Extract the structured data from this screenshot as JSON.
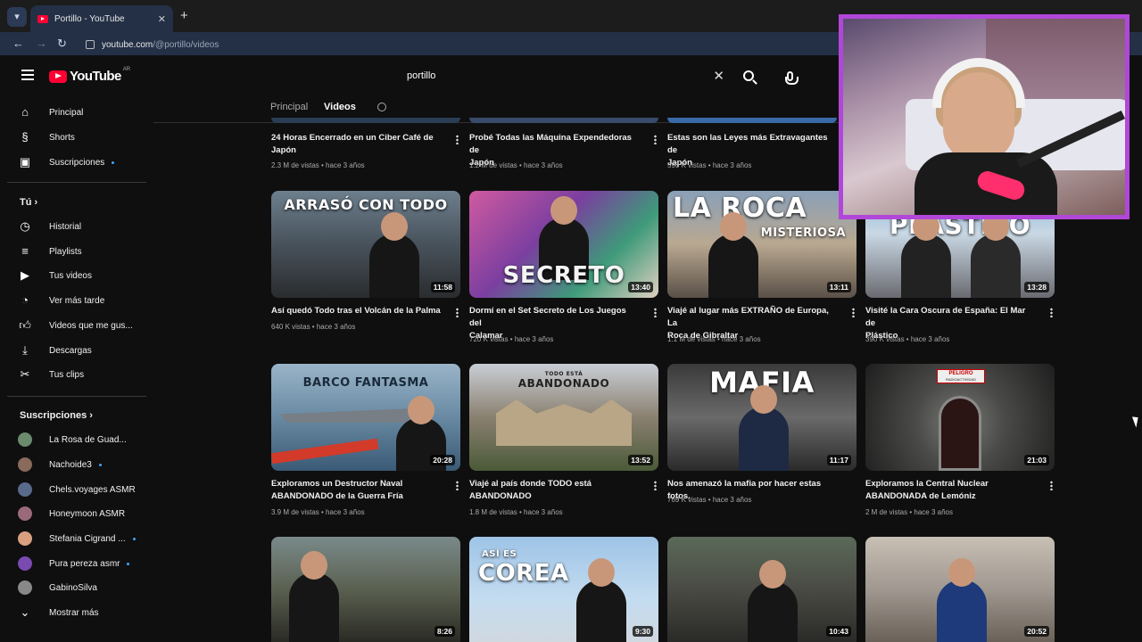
{
  "browser": {
    "tab_title": "Portillo - YouTube",
    "url_host": "youtube.com",
    "url_path": "/@portillo/videos"
  },
  "yt": {
    "logo": "YouTube",
    "country": "AR",
    "search_value": "portillo"
  },
  "sidebar": {
    "main": [
      {
        "label": "Principal",
        "icon": "home-icon"
      },
      {
        "label": "Shorts",
        "icon": "shorts-icon"
      },
      {
        "label": "Suscripciones",
        "icon": "subscriptions-icon"
      }
    ],
    "you_heading": "Tú",
    "you": [
      {
        "label": "Historial",
        "icon": "history-icon"
      },
      {
        "label": "Playlists",
        "icon": "playlists-icon"
      },
      {
        "label": "Tus videos",
        "icon": "your-videos-icon"
      },
      {
        "label": "Ver más tarde",
        "icon": "watch-later-icon"
      },
      {
        "label": "Videos que me gus...",
        "icon": "like-icon"
      },
      {
        "label": "Descargas",
        "icon": "download-icon"
      },
      {
        "label": "Tus clips",
        "icon": "clips-icon"
      }
    ],
    "subs_heading": "Suscripciones",
    "subs": [
      {
        "label": "La Rosa de Guad...",
        "color": "#6b8a6e"
      },
      {
        "label": "Nachoide3",
        "color": "#8a6a5a"
      },
      {
        "label": "Chels.voyages ASMR",
        "color": "#5a6a8a"
      },
      {
        "label": "Honeymoon ASMR",
        "color": "#9a6a7a"
      },
      {
        "label": "Stefania Cigrand ...",
        "color": "#d9a080"
      },
      {
        "label": "Pura pereza asmr",
        "color": "#7a4ab0"
      },
      {
        "label": "GabinoSilva",
        "color": "#888888"
      }
    ],
    "more": "Mostrar más"
  },
  "channel_tabs": {
    "home": "Principal",
    "videos": "Videos"
  },
  "videos_top": [
    {
      "title_1": "24 Horas Encerrado en un Ciber Café de",
      "title_2": "Japón",
      "meta": "2.3 M de vistas • hace 3 años"
    },
    {
      "title_1": "Probé Todas las Máquina Expendedoras de",
      "title_2": "Japón",
      "meta": "1.2 M de vistas • hace 3 años"
    },
    {
      "title_1": "Estas son las Leyes más Extravagantes de",
      "title_2": "Japón",
      "meta": "590 K vistas • hace 3 años"
    }
  ],
  "videos_row2": [
    {
      "caption": "ARRASÓ CON TODO",
      "duration": "11:58",
      "title_1": "Así quedó Todo tras el Volcán de la Palma",
      "title_2": "",
      "meta": "640 K vistas • hace 3 años",
      "bg": "linear-gradient(180deg,#6d7f8d 0%,#4b5660 45%,#2a2c2e 100%)"
    },
    {
      "caption": "SECRETO",
      "duration": "13:40",
      "title_1": "Dormí en el Set Secreto de Los Juegos del",
      "title_2": "Calamar",
      "meta": "720 K vistas • hace 3 años",
      "bg": "linear-gradient(135deg,#d05aa0 0%,#7b3fa0 40%,#3e9a7a 70%,#e0d0c0 100%)"
    },
    {
      "caption": "LA ROCA",
      "caption2": "MISTERIOSA",
      "duration": "13:11",
      "title_1": "Viajé al lugar más EXTRAÑO de Europa, La",
      "title_2": "Roca de Gibraltar",
      "meta": "1.1 M de vistas • hace 3 años",
      "bg": "linear-gradient(180deg,#8aa0b8 0%,#b9a890 50%,#5a5048 100%)"
    },
    {
      "caption": "PLÁSTICO",
      "duration": "13:28",
      "title_1": "Visité la Cara Oscura de España: El Mar de",
      "title_2": "Plástico",
      "meta": "390 K vistas • hace 3 años",
      "bg": "linear-gradient(180deg,#8fb4d8 0%,#c9d8e4 40%,#6a6a70 100%)"
    }
  ],
  "videos_row3": [
    {
      "caption": "BARCO FANTASMA",
      "duration": "20:28",
      "title_1": "Exploramos un Destructor Naval",
      "title_2": "ABANDONADO de la Guerra Fría",
      "meta": "3.9 M de vistas • hace 3 años",
      "bg": "linear-gradient(180deg,#9ab4c8 0%,#6d8ea6 45%,#3a5a76 100%)"
    },
    {
      "caption": "ABANDONADO",
      "caption_small": "TODO ESTÁ",
      "duration": "13:52",
      "title_1": "Viajé al país donde TODO está",
      "title_2": "ABANDONADO",
      "meta": "1.8 M de vistas • hace 3 años",
      "bg": "linear-gradient(180deg,#c9ced6 0%,#8a8070 50%,#4a5a38 100%)"
    },
    {
      "caption": "MAFIA",
      "duration": "11:17",
      "title_1": "Nos amenazó la mafia por hacer estas fotos.",
      "title_2": "",
      "meta": "769 K vistas • hace 3 años",
      "bg": "linear-gradient(180deg,#3a3a3a 0%,#6a6a6a 50%,#2a2a2a 100%)"
    },
    {
      "caption": "PELIGRO",
      "caption_small": "RADIOACTIVIDAD",
      "duration": "21:03",
      "title_1": "Exploramos la Central Nuclear",
      "title_2": "ABANDONADA de Lemóniz",
      "meta": "2 M de vistas • hace 3 años",
      "bg": "radial-gradient(circle at 50% 55%,#7a7a78 0%,#4a4a48 40%,#1e1e1e 100%)"
    }
  ],
  "videos_row4": [
    {
      "caption": "",
      "duration": "8:26",
      "bg": "linear-gradient(180deg,#7a8a8a 0%,#5a6050 50%,#2a2a24 100%)"
    },
    {
      "caption": "COREA",
      "caption_small": "ASÍ ES",
      "duration": "9:30",
      "bg": "linear-gradient(180deg,#9ec4e6 0%,#c4dcf0 60%,#d0d8e0 100%)"
    },
    {
      "caption": "",
      "duration": "10:43",
      "bg": "linear-gradient(180deg,#5a6a58 0%,#4a4a44 50%,#2a2a28 100%)"
    },
    {
      "caption": "",
      "duration": "20:52",
      "bg": "linear-gradient(180deg,#c8c0b4 0%,#a09890 50%,#6a6258 100%)"
    }
  ]
}
